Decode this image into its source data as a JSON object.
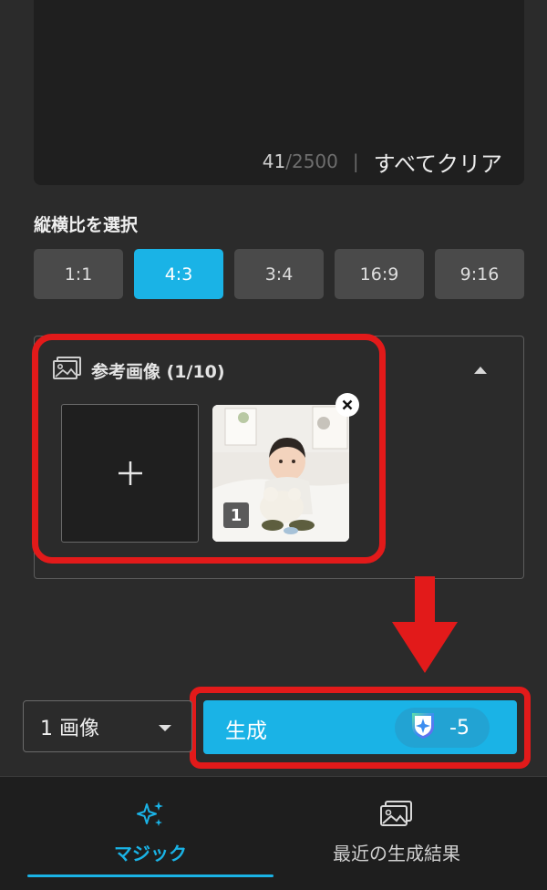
{
  "prompt": {
    "char_count": "41",
    "char_max": "/2500",
    "separator": "|",
    "clear_label": "すべてクリア"
  },
  "aspect": {
    "title": "縦横比を選択",
    "options": [
      "1:1",
      "4:3",
      "3:4",
      "16:9",
      "9:16"
    ],
    "selected": "4:3"
  },
  "reference": {
    "title": "参考画像 (1/10)",
    "image_index": "1",
    "icon": "image-icon"
  },
  "generate": {
    "count_label": "1 画像",
    "button_label": "生成",
    "cost": "-5",
    "cost_icon": "credit-shield-icon"
  },
  "tabs": {
    "magic": "マジック",
    "recent": "最近の生成結果"
  },
  "colors": {
    "accent": "#1ab3e6",
    "highlight": "#e21a1a",
    "background": "#2b2b2b"
  }
}
